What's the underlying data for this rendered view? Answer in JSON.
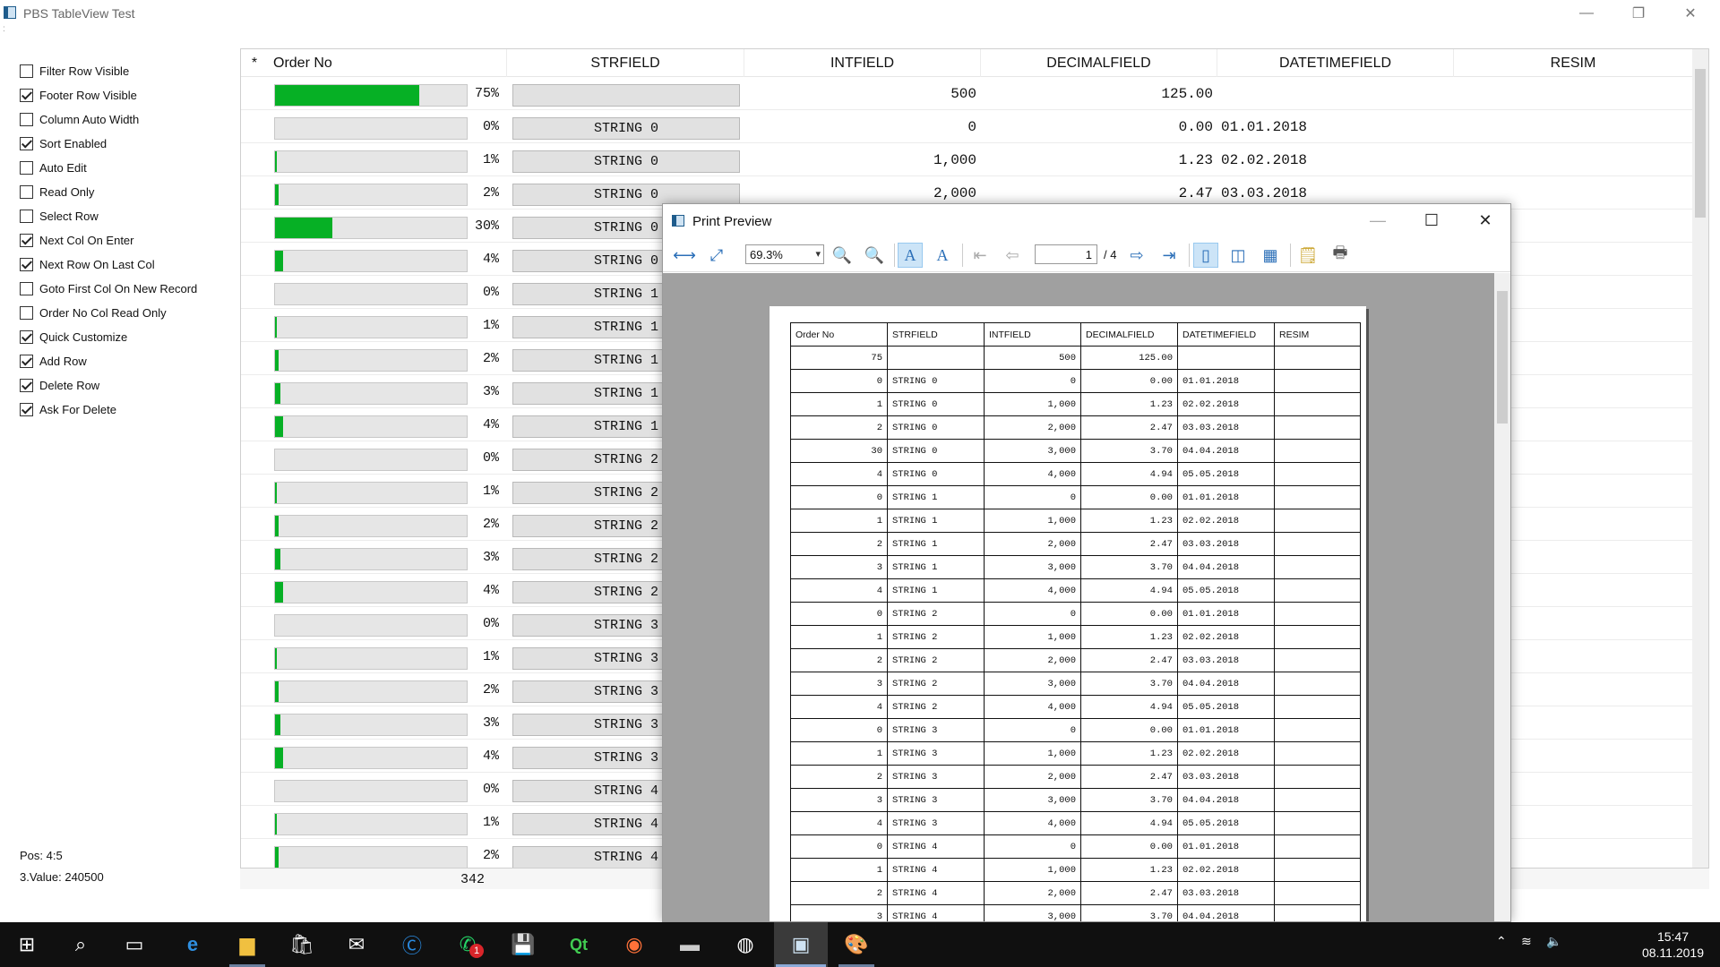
{
  "window": {
    "title": "PBS TableView Test",
    "minimize": "—",
    "restore": "❐",
    "close": "✕"
  },
  "options": [
    {
      "label": "Filter Row Visible",
      "checked": false
    },
    {
      "label": "Footer Row Visible",
      "checked": true
    },
    {
      "label": "Column Auto Width",
      "checked": false
    },
    {
      "label": "Sort Enabled",
      "checked": true
    },
    {
      "label": "Auto Edit",
      "checked": false
    },
    {
      "label": "Read Only",
      "checked": false
    },
    {
      "label": "Select Row",
      "checked": false
    },
    {
      "label": "Next Col On Enter",
      "checked": true
    },
    {
      "label": "Next Row On Last Col",
      "checked": true
    },
    {
      "label": "Goto First Col On New Record",
      "checked": false
    },
    {
      "label": "Order No Col Read Only",
      "checked": false
    },
    {
      "label": "Quick Customize",
      "checked": true
    },
    {
      "label": "Add Row",
      "checked": true
    },
    {
      "label": "Delete Row",
      "checked": true
    },
    {
      "label": "Ask For Delete",
      "checked": true
    }
  ],
  "status": {
    "pos": "Pos: 4:5",
    "value": "3.Value: 240500"
  },
  "grid": {
    "row_marker": "*",
    "columns": [
      "Order No",
      "STRFIELD",
      "INTFIELD",
      "DECIMALFIELD",
      "DATETIMEFIELD",
      "RESIM"
    ],
    "rows": [
      {
        "progress": 75,
        "progress_text": "75%",
        "str": "",
        "int": "500",
        "dec": "125.00",
        "date": ""
      },
      {
        "progress": 0,
        "progress_text": "0%",
        "str": "STRING 0",
        "int": "0",
        "dec": "0.00",
        "date": "01.01.2018"
      },
      {
        "progress": 1,
        "progress_text": "1%",
        "str": "STRING 0",
        "int": "1,000",
        "dec": "1.23",
        "date": "02.02.2018"
      },
      {
        "progress": 2,
        "progress_text": "2%",
        "str": "STRING 0",
        "int": "2,000",
        "dec": "2.47",
        "date": "03.03.2018"
      },
      {
        "progress": 30,
        "progress_text": "30%",
        "str": "STRING 0",
        "int": "",
        "dec": "",
        "date": ""
      },
      {
        "progress": 4,
        "progress_text": "4%",
        "str": "STRING 0",
        "int": "",
        "dec": "",
        "date": ""
      },
      {
        "progress": 0,
        "progress_text": "0%",
        "str": "STRING 1",
        "int": "",
        "dec": "",
        "date": ""
      },
      {
        "progress": 1,
        "progress_text": "1%",
        "str": "STRING 1",
        "int": "",
        "dec": "",
        "date": ""
      },
      {
        "progress": 2,
        "progress_text": "2%",
        "str": "STRING 1",
        "int": "",
        "dec": "",
        "date": ""
      },
      {
        "progress": 3,
        "progress_text": "3%",
        "str": "STRING 1",
        "int": "",
        "dec": "",
        "date": ""
      },
      {
        "progress": 4,
        "progress_text": "4%",
        "str": "STRING 1",
        "int": "",
        "dec": "",
        "date": ""
      },
      {
        "progress": 0,
        "progress_text": "0%",
        "str": "STRING 2",
        "int": "",
        "dec": "",
        "date": ""
      },
      {
        "progress": 1,
        "progress_text": "1%",
        "str": "STRING 2",
        "int": "",
        "dec": "",
        "date": ""
      },
      {
        "progress": 2,
        "progress_text": "2%",
        "str": "STRING 2",
        "int": "",
        "dec": "",
        "date": ""
      },
      {
        "progress": 3,
        "progress_text": "3%",
        "str": "STRING 2",
        "int": "",
        "dec": "",
        "date": ""
      },
      {
        "progress": 4,
        "progress_text": "4%",
        "str": "STRING 2",
        "int": "",
        "dec": "",
        "date": ""
      },
      {
        "progress": 0,
        "progress_text": "0%",
        "str": "STRING 3",
        "int": "",
        "dec": "",
        "date": ""
      },
      {
        "progress": 1,
        "progress_text": "1%",
        "str": "STRING 3",
        "int": "",
        "dec": "",
        "date": ""
      },
      {
        "progress": 2,
        "progress_text": "2%",
        "str": "STRING 3",
        "int": "",
        "dec": "",
        "date": ""
      },
      {
        "progress": 3,
        "progress_text": "3%",
        "str": "STRING 3",
        "int": "",
        "dec": "",
        "date": ""
      },
      {
        "progress": 4,
        "progress_text": "4%",
        "str": "STRING 3",
        "int": "",
        "dec": "",
        "date": ""
      },
      {
        "progress": 0,
        "progress_text": "0%",
        "str": "STRING 4",
        "int": "",
        "dec": "",
        "date": ""
      },
      {
        "progress": 1,
        "progress_text": "1%",
        "str": "STRING 4",
        "int": "",
        "dec": "",
        "date": ""
      },
      {
        "progress": 2,
        "progress_text": "2%",
        "str": "STRING 4",
        "int": "",
        "dec": "",
        "date": ""
      }
    ],
    "footer_sum": "342"
  },
  "preview": {
    "title": "Print Preview",
    "zoom": "69.3%",
    "page": "1",
    "page_total": "/ 4",
    "table_columns": [
      "Order No",
      "STRFIELD",
      "INTFIELD",
      "DECIMALFIELD",
      "DATETIMEFIELD",
      "RESIM"
    ],
    "table_rows": [
      [
        "75",
        "",
        "500",
        "125.00",
        "",
        ""
      ],
      [
        "0",
        "STRING 0",
        "0",
        "0.00",
        "01.01.2018",
        ""
      ],
      [
        "1",
        "STRING 0",
        "1,000",
        "1.23",
        "02.02.2018",
        ""
      ],
      [
        "2",
        "STRING 0",
        "2,000",
        "2.47",
        "03.03.2018",
        ""
      ],
      [
        "30",
        "STRING 0",
        "3,000",
        "3.70",
        "04.04.2018",
        ""
      ],
      [
        "4",
        "STRING 0",
        "4,000",
        "4.94",
        "05.05.2018",
        ""
      ],
      [
        "0",
        "STRING 1",
        "0",
        "0.00",
        "01.01.2018",
        ""
      ],
      [
        "1",
        "STRING 1",
        "1,000",
        "1.23",
        "02.02.2018",
        ""
      ],
      [
        "2",
        "STRING 1",
        "2,000",
        "2.47",
        "03.03.2018",
        ""
      ],
      [
        "3",
        "STRING 1",
        "3,000",
        "3.70",
        "04.04.2018",
        ""
      ],
      [
        "4",
        "STRING 1",
        "4,000",
        "4.94",
        "05.05.2018",
        ""
      ],
      [
        "0",
        "STRING 2",
        "0",
        "0.00",
        "01.01.2018",
        ""
      ],
      [
        "1",
        "STRING 2",
        "1,000",
        "1.23",
        "02.02.2018",
        ""
      ],
      [
        "2",
        "STRING 2",
        "2,000",
        "2.47",
        "03.03.2018",
        ""
      ],
      [
        "3",
        "STRING 2",
        "3,000",
        "3.70",
        "04.04.2018",
        ""
      ],
      [
        "4",
        "STRING 2",
        "4,000",
        "4.94",
        "05.05.2018",
        ""
      ],
      [
        "0",
        "STRING 3",
        "0",
        "0.00",
        "01.01.2018",
        ""
      ],
      [
        "1",
        "STRING 3",
        "1,000",
        "1.23",
        "02.02.2018",
        ""
      ],
      [
        "2",
        "STRING 3",
        "2,000",
        "2.47",
        "03.03.2018",
        ""
      ],
      [
        "3",
        "STRING 3",
        "3,000",
        "3.70",
        "04.04.2018",
        ""
      ],
      [
        "4",
        "STRING 3",
        "4,000",
        "4.94",
        "05.05.2018",
        ""
      ],
      [
        "0",
        "STRING 4",
        "0",
        "0.00",
        "01.01.2018",
        ""
      ],
      [
        "1",
        "STRING 4",
        "1,000",
        "1.23",
        "02.02.2018",
        ""
      ],
      [
        "2",
        "STRING 4",
        "2,000",
        "2.47",
        "03.03.2018",
        ""
      ],
      [
        "3",
        "STRING 4",
        "3,000",
        "3.70",
        "04.04.2018",
        ""
      ]
    ]
  },
  "taskbar": {
    "time": "15:47",
    "date": "08.11.2019",
    "apps": [
      "start-icon",
      "search-icon",
      "task-view-icon",
      "edge-icon",
      "file-explorer-icon",
      "store-icon",
      "mail-icon",
      "ccleaner-icon",
      "whatsapp-icon",
      "save-disk-icon",
      "qt-creator-icon",
      "firefox-icon",
      "terminal-icon",
      "github-icon",
      "tableview-app-icon",
      "paint-icon"
    ],
    "whatsapp_badge": "1"
  },
  "colors": {
    "progress_fill": "#06b025",
    "taskbar": "#101010",
    "preview_bg": "#a0a0a0"
  }
}
